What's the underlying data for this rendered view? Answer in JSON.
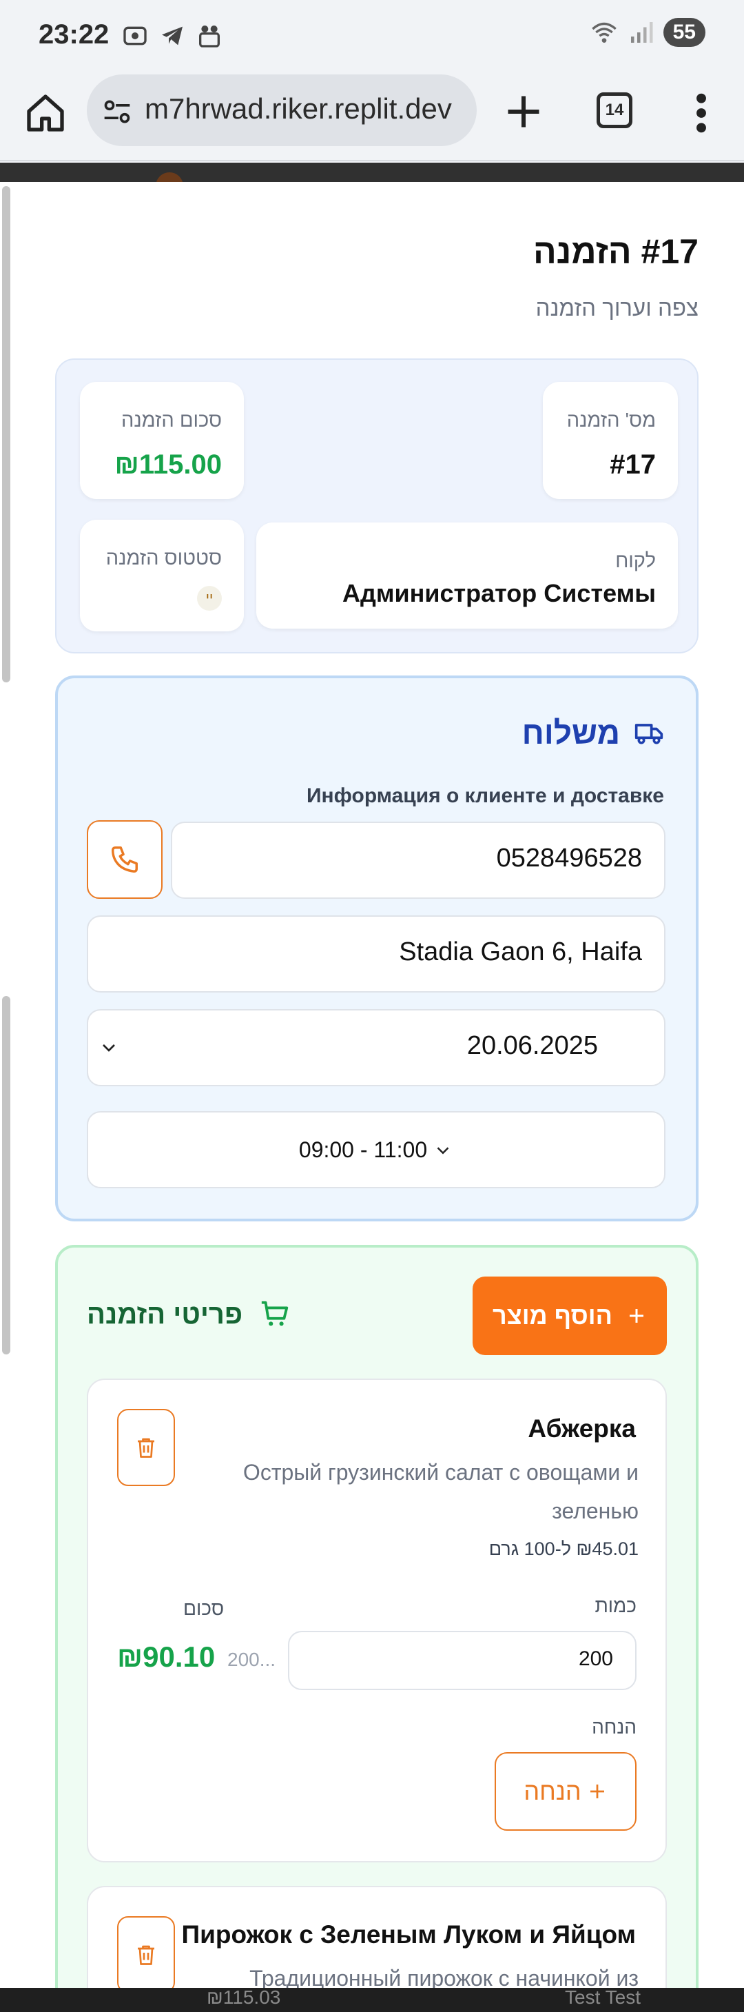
{
  "status": {
    "time": "23:22",
    "battery": "55"
  },
  "browser": {
    "url": "m7hrwad.riker.replit.dev",
    "tab_count": "14"
  },
  "page": {
    "title": "#17 הזמנה",
    "subtitle": "צפה וערוך הזמנה"
  },
  "summary": {
    "order_no_label": "מס' הזמנה",
    "order_no_value": "#17",
    "total_label": "סכום הזמנה",
    "total_value": "₪115.00",
    "customer_label": "לקוח",
    "customer_value": "Администратор Системы",
    "status_label": "סטטוס הזמנה",
    "status_badge": "יי"
  },
  "delivery": {
    "title": "משלוח",
    "subtitle": "Информация о клиенте и доставке",
    "phone": "0528496528",
    "address": "Stadia Gaon 6, Haifa",
    "date": "20.06.2025",
    "time_slot": "09:00 - 11:00"
  },
  "items": {
    "title": "פריטי הזמנה",
    "add_button": "הוסף מוצר",
    "products": [
      {
        "name": "Абжерка",
        "description": "Острый грузинский салат с овощами и зеленью",
        "price": "₪45.01 ל-100 גרם",
        "qty_label": "כמות",
        "qty_value": "200",
        "sum_label": "סכום",
        "sum_hint": "200...",
        "sum_value": "₪90.10",
        "discount_label": "הנחה",
        "discount_button": "הנחה"
      },
      {
        "name": "Пирожок с Зеленым Луком и Яйцом",
        "description": "Традиционный пирожок с начинкой из"
      }
    ]
  },
  "bottom": {
    "left_text": "₪115.03",
    "right_text": "Test Test"
  }
}
